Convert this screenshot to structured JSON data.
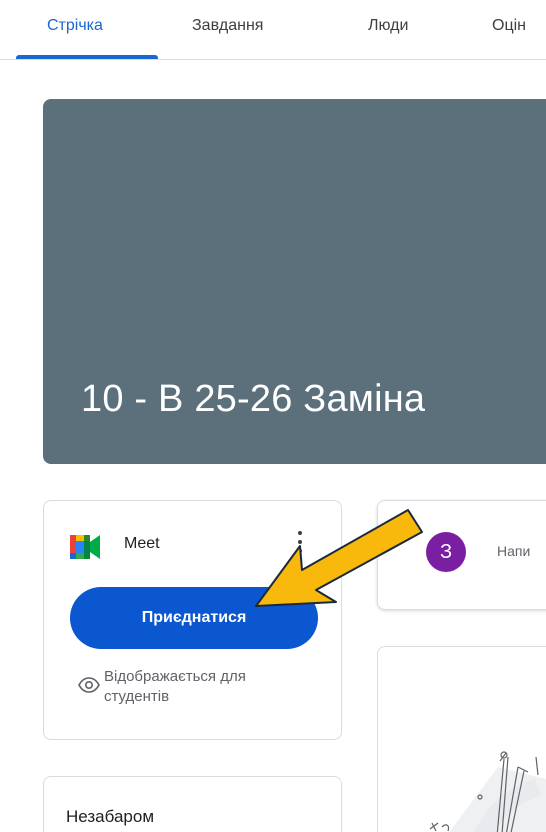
{
  "tabs": [
    {
      "label": "Стрічка",
      "active": true
    },
    {
      "label": "Завдання",
      "active": false
    },
    {
      "label": "Люди",
      "active": false
    },
    {
      "label": "Оцін",
      "active": false
    }
  ],
  "banner": {
    "title": "10 - В 25-26 Заміна",
    "color": "#5b707b"
  },
  "meet": {
    "title": "Meet",
    "join_label": "Приєднатися",
    "visibility_text": "Відображається для студентів",
    "menu_icon": "more-vert-icon",
    "eye_icon": "eye-icon"
  },
  "upcoming": {
    "title": "Незабаром"
  },
  "announce": {
    "avatar_letter": "З",
    "avatar_color": "#7b1fa2",
    "placeholder": "Напи"
  },
  "annotation": {
    "arrow_color": "#f9b90c"
  },
  "colors": {
    "accent": "#1967d2",
    "button": "#0b57d0"
  }
}
